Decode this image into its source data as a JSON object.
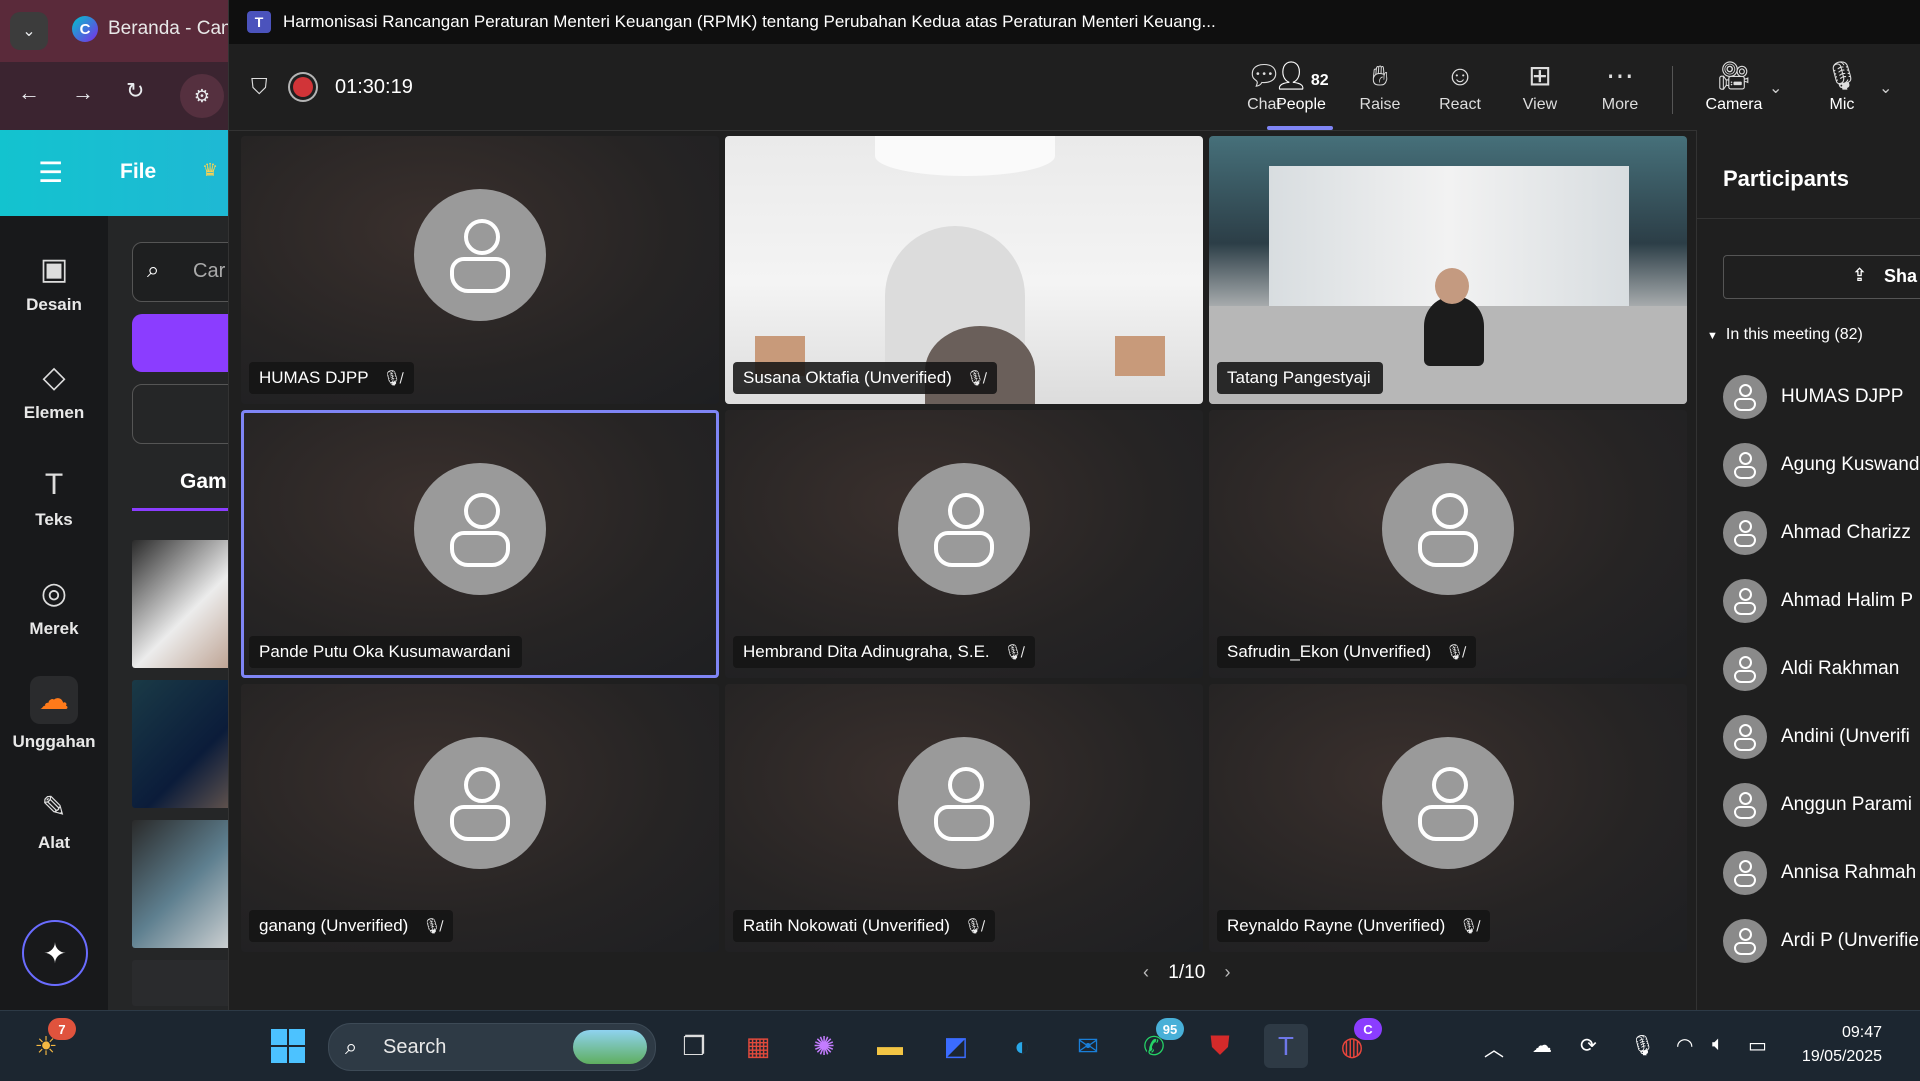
{
  "browser": {
    "tab_title": "Beranda - Canva",
    "canva": {
      "menu_file": "File",
      "search_placeholder": "Car",
      "tab_label": "Gam",
      "rail": [
        {
          "label": "Desain",
          "icon": "layout-icon"
        },
        {
          "label": "Elemen",
          "icon": "shapes-icon"
        },
        {
          "label": "Teks",
          "icon": "text-icon"
        },
        {
          "label": "Merek",
          "icon": "brand-icon"
        },
        {
          "label": "Unggahan",
          "icon": "upload-cloud-icon"
        },
        {
          "label": "Alat",
          "icon": "pen-tool-icon"
        }
      ]
    }
  },
  "meeting": {
    "title": "Harmonisasi Rancangan Peraturan Menteri Keuangan (RPMK) tentang Perubahan Kedua atas Peraturan Menteri Keuang...",
    "timer": "01:30:19",
    "controls": {
      "chat": "Chat",
      "people": "People",
      "people_count": "82",
      "raise": "Raise",
      "react": "React",
      "view": "View",
      "more": "More",
      "camera": "Camera",
      "mic": "Mic"
    },
    "tiles": [
      {
        "name": "HUMAS DJPP",
        "muted": true
      },
      {
        "name": "Susana Oktafia (Unverified)",
        "muted": true
      },
      {
        "name": "Tatang Pangestyaji",
        "muted": false
      },
      {
        "name": "Pande Putu Oka Kusumawardani",
        "muted": false
      },
      {
        "name": "Hembrand Dita Adinugraha, S.E.",
        "muted": true
      },
      {
        "name": "Safrudin_Ekon (Unverified)",
        "muted": true
      },
      {
        "name": "ganang (Unverified)",
        "muted": true
      },
      {
        "name": "Ratih Nokowati (Unverified)",
        "muted": true
      },
      {
        "name": "Reynaldo Rayne (Unverified)",
        "muted": true
      }
    ],
    "pager": "1/10",
    "participants_panel": {
      "title": "Participants",
      "share_label": "Sha",
      "section": "In this meeting (82)",
      "list": [
        "HUMAS DJPP",
        "Agung Kuswand",
        "Ahmad Charizz",
        "Ahmad Halim P",
        "Aldi Rakhman",
        "Andini (Unverifi",
        "Anggun Parami",
        "Annisa Rahmah",
        "Ardi P (Unverifie"
      ]
    }
  },
  "taskbar": {
    "weather_badge": "7",
    "search_label": "Search",
    "whatsapp_badge": "95",
    "chrome_badge": "C",
    "time": "09:47",
    "date": "19/05/2025"
  },
  "colors": {
    "accent": "#7f85f5",
    "record": "#d13438",
    "canva_purple": "#8b3dff",
    "canva_header": "#13c3cf"
  }
}
